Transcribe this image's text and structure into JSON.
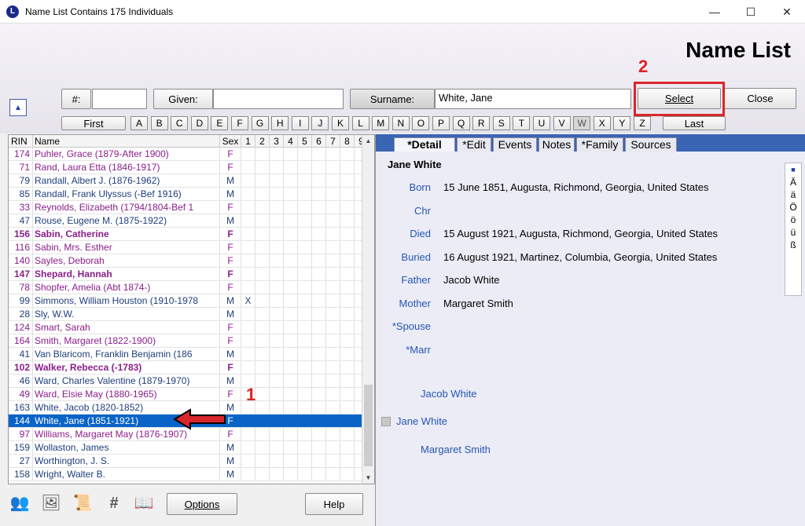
{
  "window": {
    "title": "Name List Contains 175 Individuals",
    "app_icon": "L",
    "controls": {
      "minimize": "—",
      "maximize": "☐",
      "close": "✕"
    }
  },
  "header": {
    "page_title": "Name List",
    "number_label": "#:",
    "number_value": "",
    "given_label": "Given:",
    "given_value": "",
    "surname_label": "Surname:",
    "surname_value": "White, Jane",
    "select_label": "Select",
    "close_label": "Close",
    "first_label": "First",
    "last_label": "Last",
    "up_icon": "▲",
    "letters": [
      "A",
      "B",
      "C",
      "D",
      "E",
      "F",
      "G",
      "H",
      "I",
      "J",
      "K",
      "L",
      "M",
      "N",
      "O",
      "P",
      "Q",
      "R",
      "S",
      "T",
      "U",
      "V",
      "W",
      "X",
      "Y",
      "Z"
    ],
    "active_letter": "W"
  },
  "annotations": {
    "one": "1",
    "two": "2"
  },
  "list": {
    "columns": {
      "rin": "RIN",
      "name": "Name",
      "sex": "Sex",
      "nums": [
        "1",
        "2",
        "3",
        "4",
        "5",
        "6",
        "7",
        "8",
        "9"
      ]
    },
    "rows": [
      {
        "rin": "174",
        "name": "Puhler, Grace (1879-After 1900)",
        "sex": "F",
        "mark": ""
      },
      {
        "rin": "71",
        "name": "Rand, Laura Etta (1846-1917)",
        "sex": "F",
        "mark": ""
      },
      {
        "rin": "79",
        "name": "Randall, Albert J. (1876-1962)",
        "sex": "M",
        "mark": ""
      },
      {
        "rin": "85",
        "name": "Randall, Frank Ulyssus (-Bef 1916)",
        "sex": "M",
        "mark": ""
      },
      {
        "rin": "33",
        "name": "Reynolds, Elizabeth (1794/1804-Bef 1",
        "sex": "F",
        "mark": ""
      },
      {
        "rin": "47",
        "name": "Rouse, Eugene M. (1875-1922)",
        "sex": "M",
        "mark": ""
      },
      {
        "rin": "156",
        "name": "Sabin, Catherine",
        "sex": "F",
        "mark": "",
        "bold": true
      },
      {
        "rin": "116",
        "name": "Sabin, Mrs. Esther",
        "sex": "F",
        "mark": ""
      },
      {
        "rin": "140",
        "name": "Sayles, Deborah",
        "sex": "F",
        "mark": ""
      },
      {
        "rin": "147",
        "name": "Shepard, Hannah",
        "sex": "F",
        "mark": "",
        "bold": true
      },
      {
        "rin": "78",
        "name": "Shopfer, Amelia (Abt 1874-)",
        "sex": "F",
        "mark": ""
      },
      {
        "rin": "99",
        "name": "Simmons, William Houston (1910-1978",
        "sex": "M",
        "mark": "X"
      },
      {
        "rin": "28",
        "name": "Sly, W.W.",
        "sex": "M",
        "mark": ""
      },
      {
        "rin": "124",
        "name": "Smart, Sarah",
        "sex": "F",
        "mark": ""
      },
      {
        "rin": "164",
        "name": "Smith, Margaret (1822-1900)",
        "sex": "F",
        "mark": ""
      },
      {
        "rin": "41",
        "name": "Van Blaricom, Franklin Benjamin (186",
        "sex": "M",
        "mark": ""
      },
      {
        "rin": "102",
        "name": "Walker, Rebecca (-1783)",
        "sex": "F",
        "mark": "",
        "bold": true
      },
      {
        "rin": "46",
        "name": "Ward, Charles Valentine (1879-1970)",
        "sex": "M",
        "mark": ""
      },
      {
        "rin": "49",
        "name": "Ward, Elsie May (1880-1965)",
        "sex": "F",
        "mark": ""
      },
      {
        "rin": "163",
        "name": "White, Jacob (1820-1852)",
        "sex": "M",
        "mark": ""
      },
      {
        "rin": "144",
        "name": "White, Jane (1851-1921)",
        "sex": "F",
        "mark": "",
        "selected": true
      },
      {
        "rin": "97",
        "name": "Williams, Margaret May (1876-1907)",
        "sex": "F",
        "mark": ""
      },
      {
        "rin": "159",
        "name": "Wollaston, James",
        "sex": "M",
        "mark": ""
      },
      {
        "rin": "27",
        "name": "Worthington, J. S.",
        "sex": "M",
        "mark": ""
      },
      {
        "rin": "158",
        "name": "Wright, Walter B.",
        "sex": "M",
        "mark": ""
      }
    ]
  },
  "detail": {
    "tabs": [
      "*Detail",
      "*Edit",
      "Events",
      "Notes",
      "*Family",
      "Sources"
    ],
    "person_name": "Jane White",
    "fields": [
      {
        "label": "Born",
        "value": "15 June 1851, Augusta, Richmond, Georgia, United States"
      },
      {
        "label": "Chr",
        "value": ""
      },
      {
        "label": "Died",
        "value": "15 August 1921, Augusta, Richmond, Georgia, United States"
      },
      {
        "label": "Buried",
        "value": "16 August 1921, Martinez, Columbia, Georgia, United States"
      },
      {
        "label": "Father",
        "value": "Jacob White"
      },
      {
        "label": "Mother",
        "value": "Margaret Smith"
      },
      {
        "label": "*Spouse",
        "value": ""
      },
      {
        "label": "*Marr",
        "value": ""
      }
    ],
    "tree": {
      "father": "Jacob White",
      "self": "Jane White",
      "mother": "Margaret Smith"
    },
    "chars": [
      "■",
      "Ä",
      "ä",
      "Ö",
      "ö",
      "ü",
      "ß"
    ]
  },
  "footer": {
    "options_label": "Options",
    "help_label": "Help"
  }
}
